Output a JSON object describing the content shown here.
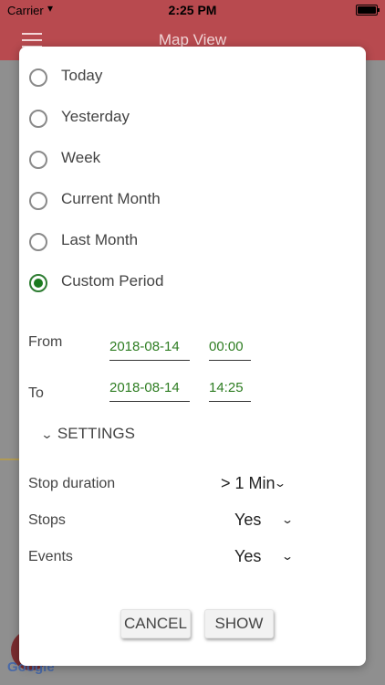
{
  "status_bar": {
    "carrier": "Carrier",
    "time": "2:25 PM"
  },
  "navbar": {
    "title": "Map View"
  },
  "map": {
    "attribution": "Google"
  },
  "dialog": {
    "period_options": [
      {
        "label": "Today",
        "selected": false
      },
      {
        "label": "Yesterday",
        "selected": false
      },
      {
        "label": "Week",
        "selected": false
      },
      {
        "label": "Current Month",
        "selected": false
      },
      {
        "label": "Last Month",
        "selected": false
      },
      {
        "label": "Custom Period",
        "selected": true
      }
    ],
    "from": {
      "label": "From",
      "date": "2018-08-14",
      "time": "00:00"
    },
    "to": {
      "label": "To",
      "date": "2018-08-14",
      "time": "14:25"
    },
    "settings_label": "SETTINGS",
    "settings": [
      {
        "label": "Stop duration",
        "value": "> 1 Min"
      },
      {
        "label": "Stops",
        "value": "Yes"
      },
      {
        "label": "Events",
        "value": "Yes"
      }
    ],
    "cancel_label": "CANCEL",
    "show_label": "SHOW"
  },
  "colors": {
    "accent": "#b84a4f",
    "selected_radio": "#1b7a1f",
    "value_text": "#2e7d22"
  }
}
